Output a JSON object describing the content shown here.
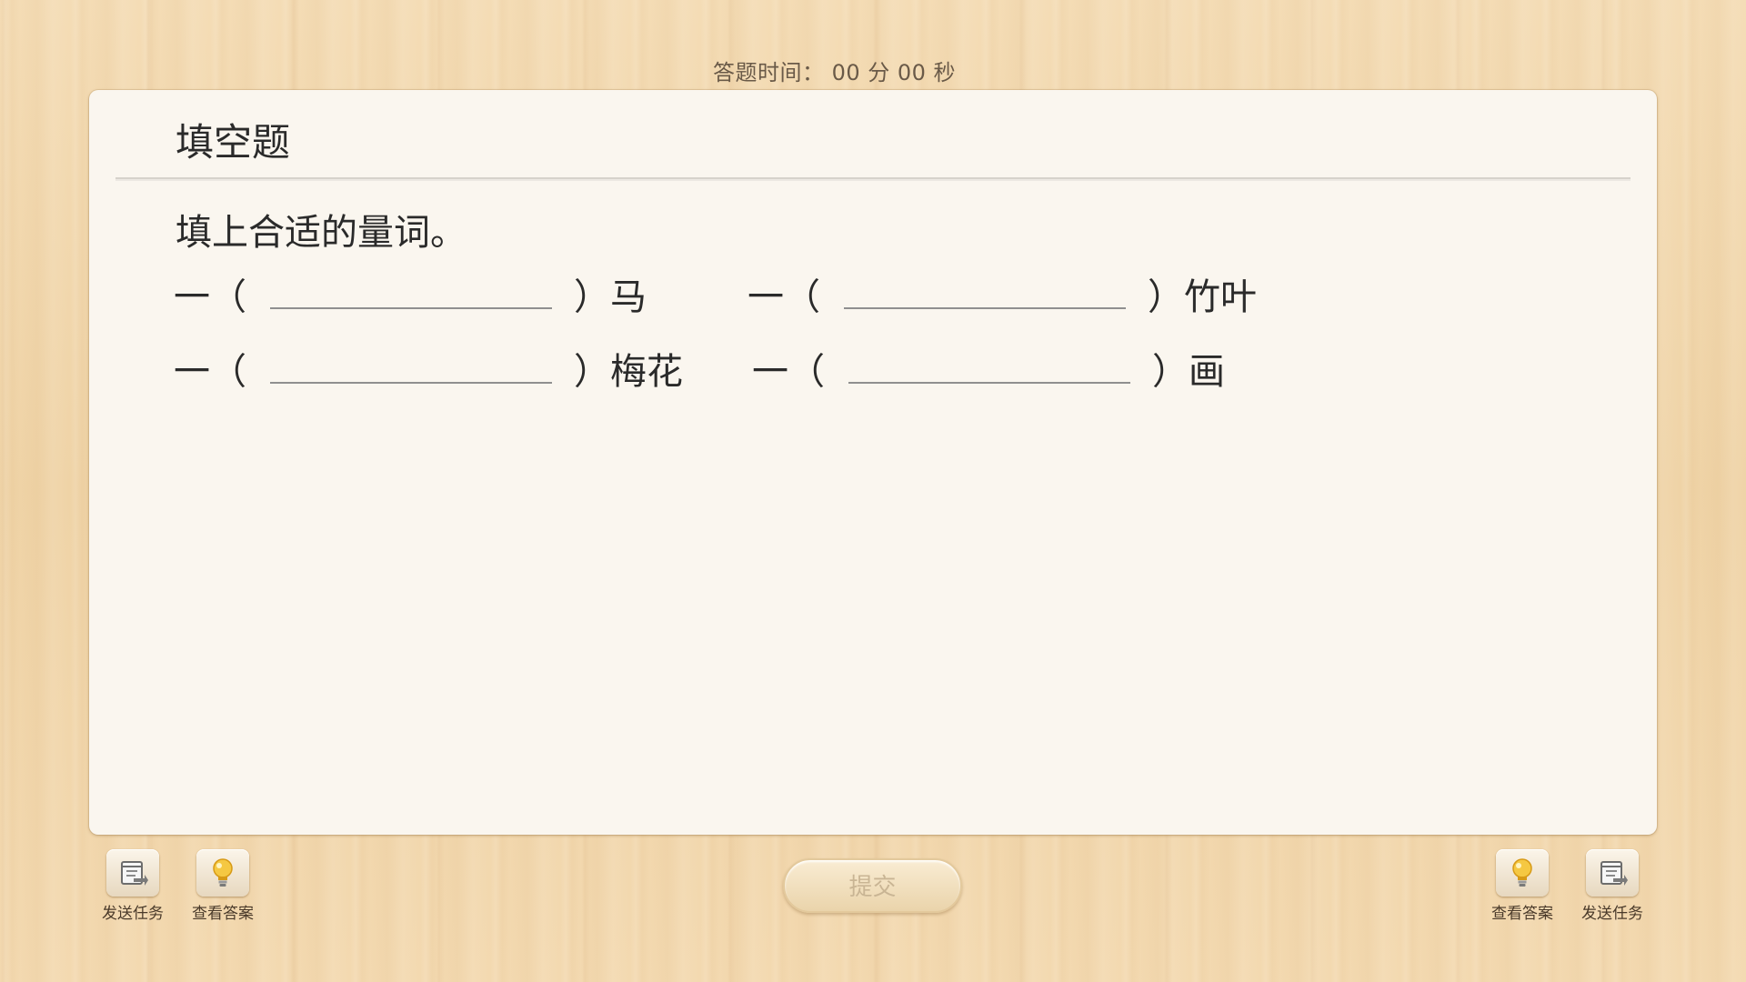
{
  "timer": {
    "text": "答题时间： 00 分 00 秒"
  },
  "question": {
    "type_title": "填空题",
    "instruction": "填上合适的量词。",
    "items": [
      {
        "prefix": "一（",
        "answer": "",
        "suffix": "）马"
      },
      {
        "prefix": "一（",
        "answer": "",
        "suffix": "）竹叶"
      },
      {
        "prefix": "一（",
        "answer": "",
        "suffix": "）梅花"
      },
      {
        "prefix": "一（",
        "answer": "",
        "suffix": "）画"
      }
    ]
  },
  "toolbar": {
    "send_task_label": "发送任务",
    "view_answer_label": "查看答案",
    "submit_label": "提交"
  },
  "icons": {
    "send_task": "send-task-icon",
    "view_answer": "lightbulb-icon"
  },
  "colors": {
    "card_background": "#faf6ef",
    "wood_background": "#f1d8b0",
    "submit_text": "#c9b594",
    "bulb": "#f2c13a"
  }
}
